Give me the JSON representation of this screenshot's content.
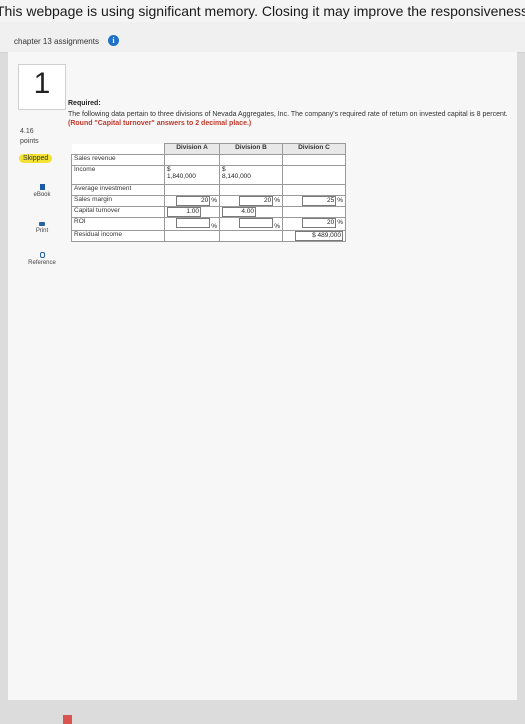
{
  "banner": {
    "text": "This webpage is using significant memory. Closing it may improve the responsiveness o"
  },
  "assignment": {
    "title": "chapter 13 assignments",
    "info_icon": "i"
  },
  "question": {
    "number": "1",
    "points_value": "4.16",
    "points_label": "points",
    "status": "Skipped"
  },
  "sidebar_tools": [
    {
      "label": "eBook",
      "icon": "book-icon"
    },
    {
      "label": "Print",
      "icon": "print-icon"
    },
    {
      "label": "Reference",
      "icon": "reference-icon"
    }
  ],
  "required": {
    "heading": "Required:",
    "text": "The following data pertain to three divisions of Nevada Aggregates, Inc. The company's required rate of return on invested capital is 8 percent.",
    "round_note": "(Round \"Capital turnover\" answers to 2 decimal place.)"
  },
  "table": {
    "headers": [
      "Division A",
      "Division B",
      "Division C"
    ],
    "rows": {
      "sales_revenue": "Sales revenue",
      "income": "Income",
      "average_investment": "Average investment",
      "sales_margin": "Sales margin",
      "capital_turnover": "Capital turnover",
      "roi": "ROI",
      "residual_income": "Residual income"
    },
    "values": {
      "a_income_prefix": "$",
      "a_income": "1,840,000",
      "b_income_prefix": "$",
      "b_income": "8,140,000",
      "a_sales_margin": "20",
      "b_sales_margin": "20",
      "c_sales_margin": "25",
      "a_capital_turnover": "1.00",
      "b_capital_turnover": "4.00",
      "c_roi": "20",
      "c_residual_income": "$ 489,000",
      "pct": "%"
    }
  }
}
